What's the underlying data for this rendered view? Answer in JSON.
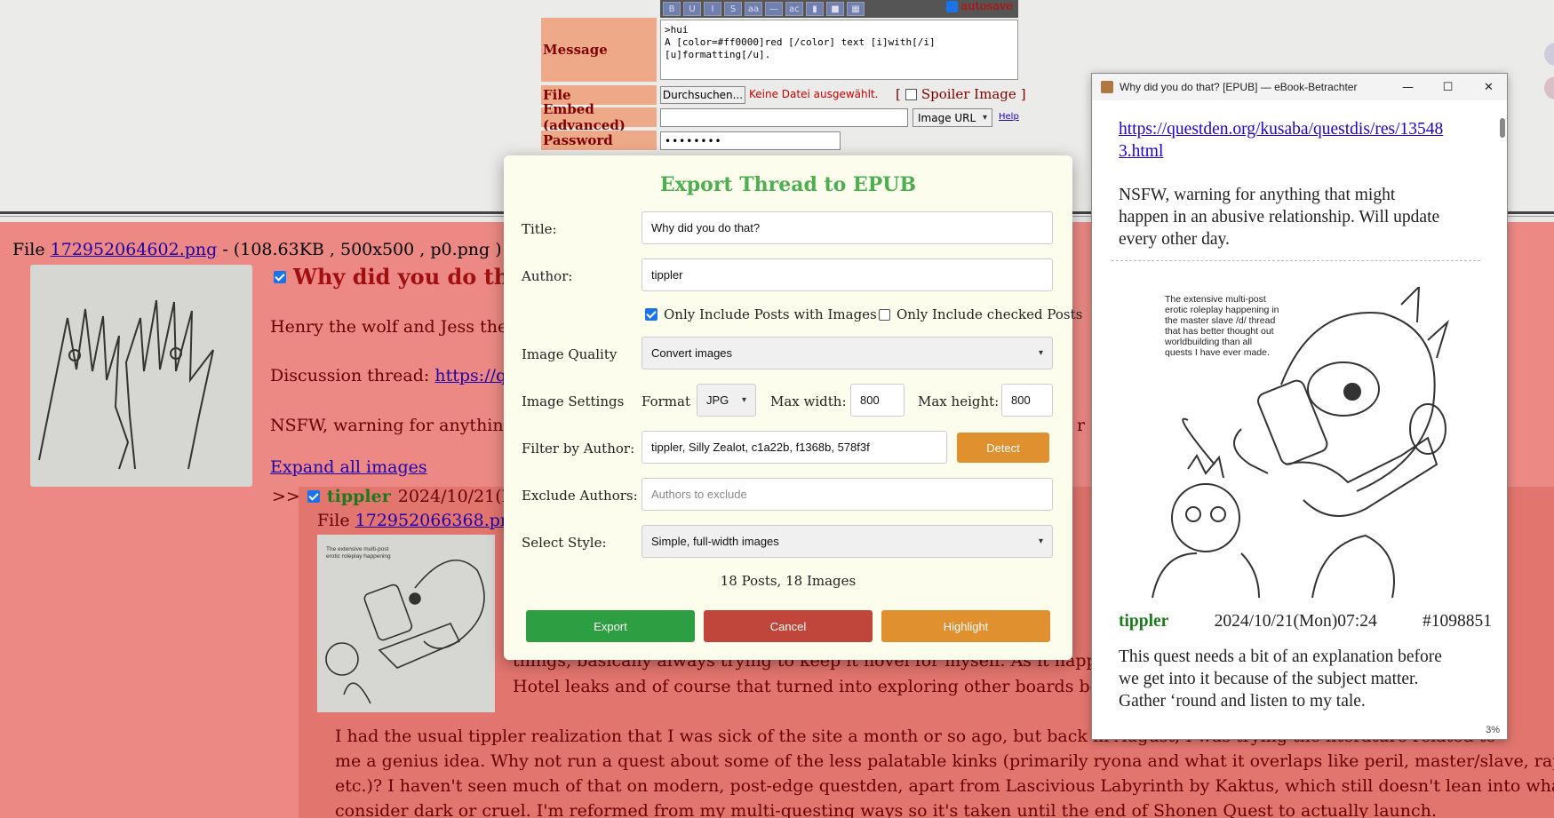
{
  "post_form": {
    "autosave_label": "autosave",
    "message_label": "Message",
    "message_value": ">hui\nA [color=#ff0000]red [/color] text [i]with[/i]\n[u]formatting[/u].",
    "file_label": "File",
    "browse_button": "Durchsuchen...",
    "no_file_text": "Keine Datei ausgewählt.",
    "spoiler_label": "Spoiler Image",
    "spoiler_open": "[",
    "spoiler_close": "]",
    "embed_label": "Embed (advanced)",
    "embed_type": "Image URL",
    "help_link": "Help",
    "password_label": "Password",
    "password_value": "••••••••"
  },
  "thread": {
    "file_prefix": "File",
    "file_link": "172952064602.png",
    "file_meta": " - (108.63KB , 500x500 , p0.png )",
    "title": "Why did you do tha",
    "line1": "Henry the wolf and Jess the",
    "line2_prefix": "Discussion thread:",
    "line2_link": "https://q",
    "line3": "NSFW, warning for anything",
    "line3_tail": "r d",
    "expand_link": "Expand all images",
    "reply": {
      "marker": ">>",
      "name": "tippler",
      "date": "2024/10/21(M",
      "file_prefix": "File",
      "file_link": "172952066368.png",
      "text_o": "o",
      "text_q": "q",
      "line_a": "things, basically always trying to keep it novel for myself. As it happens",
      "line_b": "Hotel leaks and of course that turned into exploring other boards besid",
      "para_1": "I had the usual tippler realization that I was sick of the site a month or so ago, but back in August, I was trying the literature related to",
      "para_2": "me a genius idea. Why not run a quest about some of the less palatable kinks (primarily ryona and what it overlaps like peril, master/slave, rape,",
      "para_3": "etc.)? I haven't seen much of that on modern, post-edge questden, apart from Lascivious Labyrinth by Kaktus, which still doesn't lean into what I",
      "para_4": "consider dark or cruel. I'm reformed from my multi-questing ways so it's taken until the end of Shonen Quest to actually launch."
    }
  },
  "export_modal": {
    "title": "Export Thread to EPUB",
    "title_label": "Title:",
    "title_value": "Why did you do that?",
    "author_label": "Author:",
    "author_value": "tippler",
    "only_images_label": "Only Include Posts with Images",
    "only_images_checked": true,
    "only_checked_label": "Only Include checked Posts",
    "only_checked_checked": false,
    "quality_label": "Image Quality",
    "quality_value": "Convert images",
    "settings_label": "Image Settings",
    "format_label": "Format",
    "format_value": "JPG",
    "max_width_label": "Max width:",
    "max_width_value": "800",
    "max_height_label": "Max height:",
    "max_height_value": "800",
    "filter_label": "Filter by Author:",
    "filter_value": "tippler, Silly Zealot, c1a22b, f1368b, 578f3f",
    "detect_button": "Detect",
    "exclude_label": "Exclude Authors:",
    "exclude_placeholder": "Authors to exclude",
    "style_label": "Select Style:",
    "style_value": "Simple, full-width images",
    "summary": "18 Posts, 18 Images",
    "export_button": "Export",
    "cancel_button": "Cancel",
    "highlight_button": "Highlight",
    "colors": {
      "title": "#4caf50",
      "export": "#2e9e43",
      "cancel": "#c0453b",
      "highlight": "#e0902f",
      "detect": "#e0902f"
    }
  },
  "ebook_viewer": {
    "window_title": "Why did you do that? [EPUB] — eBook-Betrachter",
    "minimize_icon": "—",
    "maximize_icon": "☐",
    "close_icon": "✕",
    "link_line1": "https://questden.org/kusaba/questdis/res/13548",
    "link_line2": "3.html",
    "intro_1": "NSFW, warning for anything that might",
    "intro_2": "happen in an abusive relationship. Will update",
    "intro_3": "every other day.",
    "image_text": "The extensive multi-post erotic roleplay happening in the master slave /d/ thread that has better thought out worldbuilding than all quests I have ever made.",
    "post_author": "tippler",
    "post_date": "2024/10/21(Mon)07:24",
    "post_number": "#1098851",
    "body_1": "This quest needs a bit of an explanation before",
    "body_2": "we get into it because of the subject matter.",
    "body_3": "Gather ‘round and listen to my tale.",
    "progress": "3%"
  }
}
